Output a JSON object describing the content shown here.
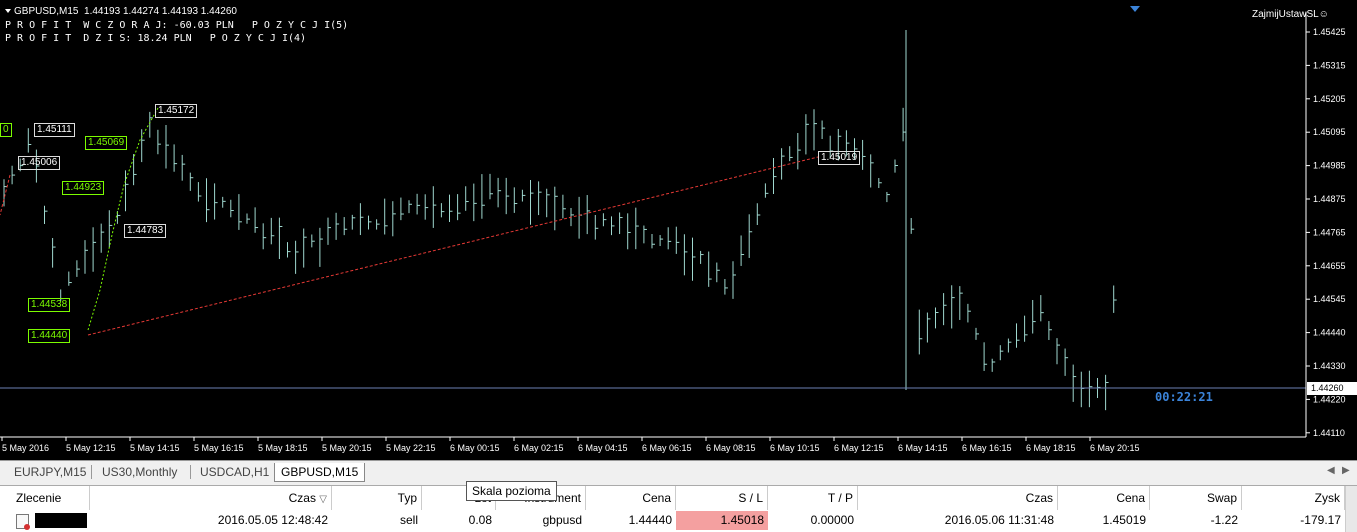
{
  "chart": {
    "symbol_line": "GBPUSD,M15  1.44193 1.44274 1.44193 1.44260",
    "profit_yesterday": "P R O F I T  W C Z O R A J: -60.03 PLN   P O Z Y C J I(5)",
    "profit_today": "P R O F I T  D Z I S: 18.24 PLN   P O Z Y C J I(4)",
    "indicator": "ZajmijUstawSL☺",
    "countdown": "00:22:21",
    "current_price": "1.44260",
    "price_ticks": [
      "1.45425",
      "1.45315",
      "1.45205",
      "1.45095",
      "1.44985",
      "1.44875",
      "1.44765",
      "1.44655",
      "1.44545",
      "1.44440",
      "1.44330",
      "1.44220",
      "1.44110"
    ],
    "time_ticks": [
      "5 May 2016",
      "5 May 12:15",
      "5 May 14:15",
      "5 May 16:15",
      "5 May 18:15",
      "5 May 20:15",
      "5 May 22:15",
      "6 May 00:15",
      "6 May 02:15",
      "6 May 04:15",
      "6 May 06:15",
      "6 May 08:15",
      "6 May 10:15",
      "6 May 12:15",
      "6 May 14:15",
      "6 May 16:15",
      "6 May 18:15",
      "6 May 20:15"
    ],
    "trade_labels": {
      "a": "1.45111",
      "b": "1.45006",
      "c": "1.45069",
      "d": "1.44923",
      "e": "1.45172",
      "f": "1.44783",
      "g": "1.44538",
      "h": "1.44440",
      "i": "1.45019",
      "j": "0"
    },
    "colors": {
      "bg": "#000000",
      "candle": "#9fd8cf",
      "trade_line": "#e53935",
      "green": "#7cfc00",
      "price_line": "#6c7fb5",
      "countdown": "#3b83d8"
    }
  },
  "tabs": [
    {
      "label": "EURJPY,M15"
    },
    {
      "label": "US30,Monthly"
    },
    {
      "label": "USDCAD,H1"
    },
    {
      "label": "GBPUSD,M15"
    }
  ],
  "tooltip": "Skala pozioma",
  "table": {
    "headers": {
      "zlecenie": "Zlecenie",
      "czas": "Czas",
      "typ": "Typ",
      "lot": "Lot",
      "instrument": "Instrument",
      "cena": "Cena",
      "sl": "S / L",
      "tp": "T / P",
      "czas2": "Czas",
      "cena2": "Cena",
      "swap": "Swap",
      "zysk": "Zysk"
    },
    "row": {
      "czas": "2016.05.05 12:48:42",
      "typ": "sell",
      "lot": "0.08",
      "instrument": "gbpusd",
      "cena": "1.44440",
      "sl": "1.45018",
      "tp": "0.00000",
      "czas2": "2016.05.06 11:31:48",
      "cena2": "1.45019",
      "swap": "-1.22",
      "zysk": "-179.17"
    }
  }
}
